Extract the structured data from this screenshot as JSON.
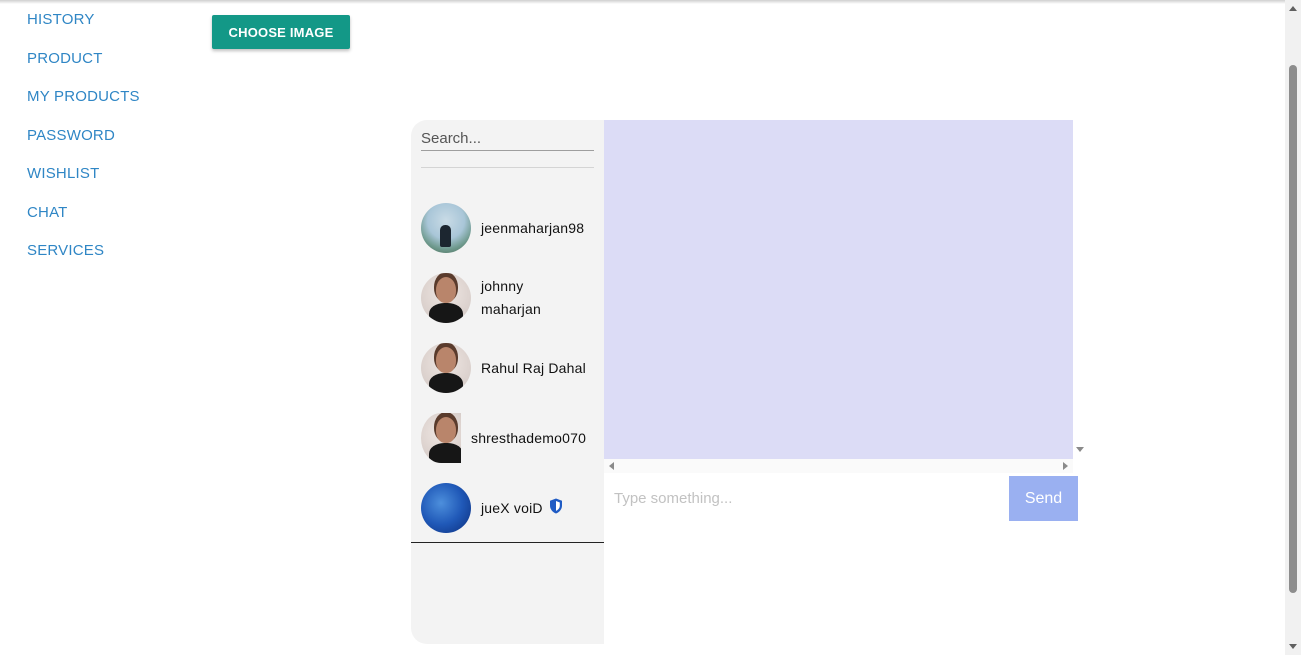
{
  "nav": {
    "items": [
      {
        "label": "HISTORY"
      },
      {
        "label": "PRODUCT"
      },
      {
        "label": "MY PRODUCTS"
      },
      {
        "label": "PASSWORD"
      },
      {
        "label": "WISHLIST"
      },
      {
        "label": "CHAT"
      },
      {
        "label": "SERVICES"
      }
    ]
  },
  "upload": {
    "choose_label": "CHOOSE IMAGE"
  },
  "chat": {
    "search_placeholder": "Search...",
    "contacts": [
      {
        "name": "jeenmaharjan98",
        "avatar": "photo-avatar"
      },
      {
        "name": "johnny maharjan",
        "avatar": "person-avatar"
      },
      {
        "name": "Rahul Raj Dahal",
        "avatar": "person-avatar"
      },
      {
        "name": "shresthademo070",
        "avatar": "person-avatar"
      },
      {
        "name": "jueX voiD",
        "avatar": "wave-avatar",
        "badge": "shield-icon"
      }
    ],
    "input_placeholder": "Type something...",
    "send_label": "Send"
  },
  "colors": {
    "nav_link": "#2f86c5",
    "choose_button": "#139887",
    "messages_bg": "#dcdcf6",
    "send_button": "#9ab0f1",
    "contacts_bg": "#f3f3f3",
    "shield": "#1f5bc4"
  }
}
